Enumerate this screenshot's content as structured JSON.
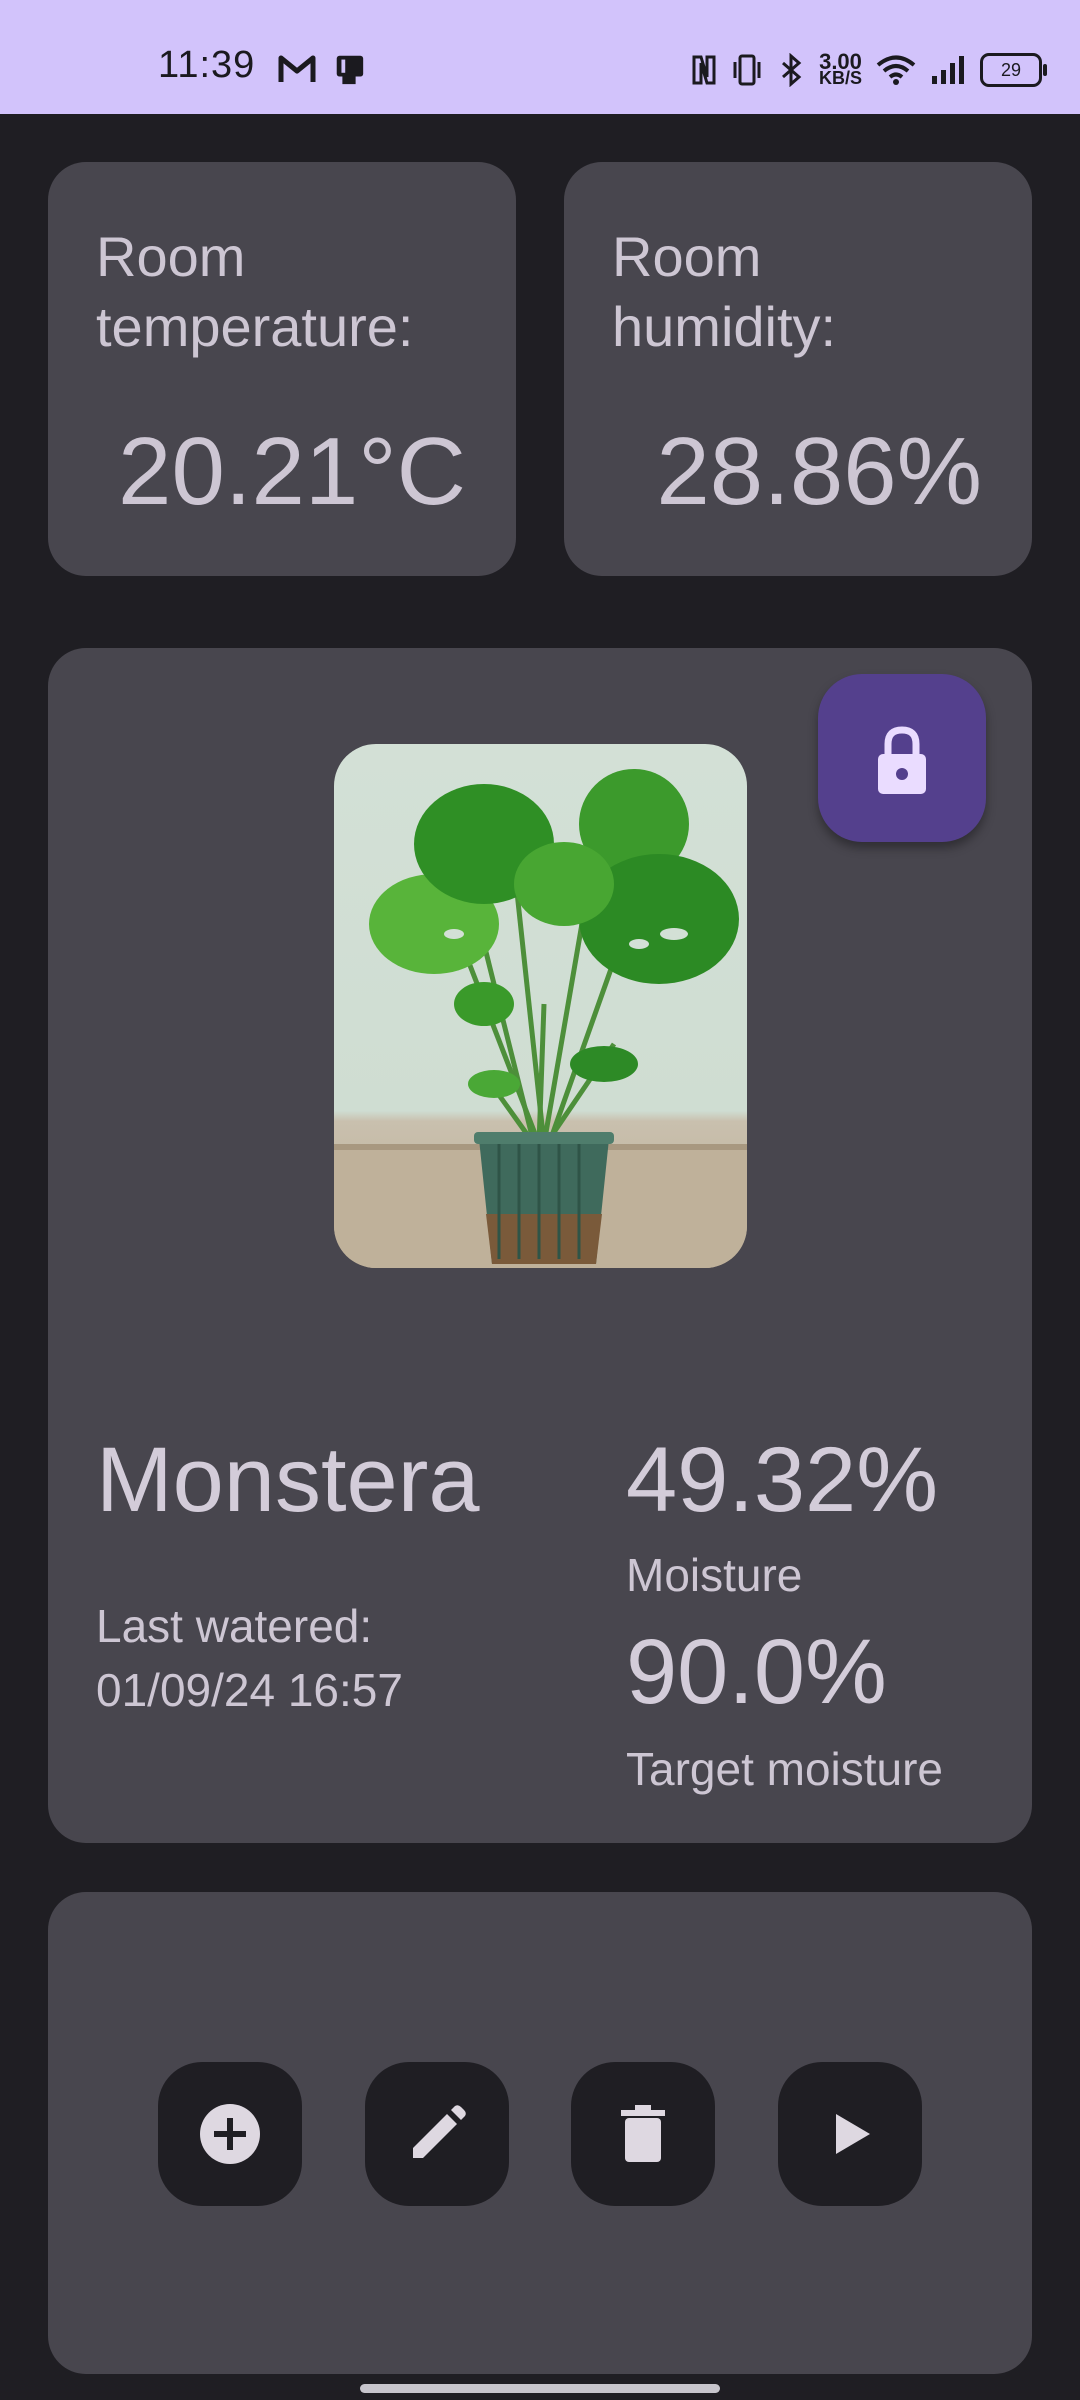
{
  "status_bar": {
    "time": "11:39",
    "speed_value": "3.00",
    "speed_unit": "KB/S",
    "battery": "29",
    "icons": [
      "gmail-icon",
      "notification-icon",
      "nfc-icon",
      "vibrate-icon",
      "bluetooth-icon",
      "wifi-icon",
      "signal-icon",
      "battery-icon"
    ]
  },
  "room": {
    "temperature_label": "Room temperature:",
    "temperature_value": "20.21°C",
    "humidity_label": "Room humidity:",
    "humidity_value": "28.86%"
  },
  "plant": {
    "name": "Monstera",
    "last_watered_label": "Last watered:",
    "last_watered_value": "01/09/24 16:57",
    "moisture_value": "49.32%",
    "moisture_label": "Moisture",
    "target_value": "90.0%",
    "target_label": "Target moisture",
    "lock_icon": "lock-icon"
  },
  "actions": [
    {
      "icon": "add-circle-icon"
    },
    {
      "icon": "edit-pencil-icon"
    },
    {
      "icon": "delete-icon"
    },
    {
      "icon": "play-icon"
    }
  ],
  "colors": {
    "status_bar_bg": "#d2c3fb",
    "background": "#1f1e23",
    "card": "#48464e",
    "accent_button": "#54408d",
    "text": "#cdc6d3"
  }
}
